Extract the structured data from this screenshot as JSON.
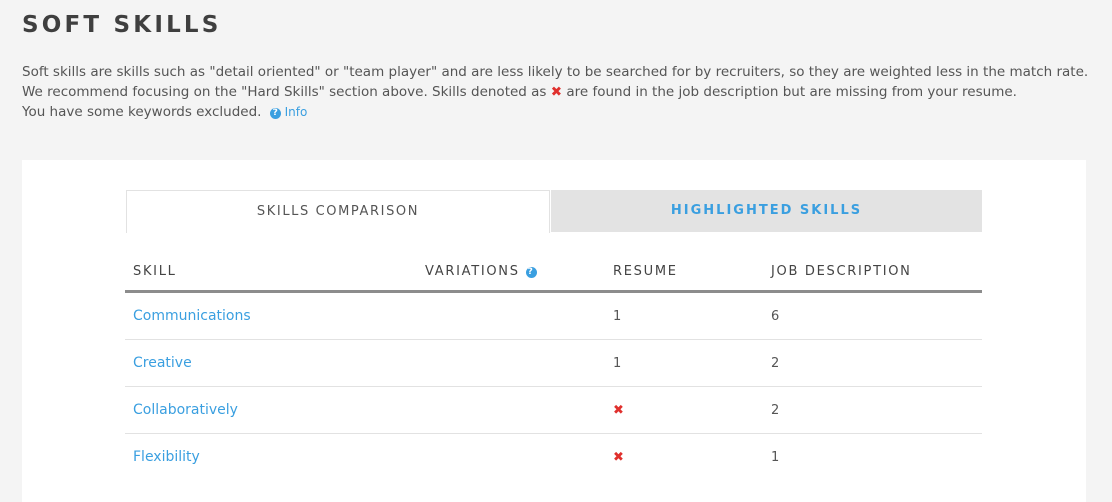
{
  "section": {
    "title": "SOFT SKILLS",
    "description_part1": "Soft skills are skills such as \"detail oriented\" or \"team player\" and are less likely to be searched for by recruiters, so they are weighted less in the match rate. We recommend focusing on the \"Hard Skills\" section above. Skills denoted as ",
    "missing_icon": "✖",
    "description_part2": " are found in the job description but are missing from your resume.",
    "excluded_text": "You have some keywords excluded.",
    "info_icon": "?",
    "info_label": "Info"
  },
  "tabs": [
    {
      "label": "SKILLS COMPARISON",
      "active": true
    },
    {
      "label": "HIGHLIGHTED SKILLS",
      "active": false
    }
  ],
  "table": {
    "headers": {
      "skill": "SKILL",
      "variations": "VARIATIONS",
      "variations_help_icon": "?",
      "resume": "RESUME",
      "job_description": "JOB DESCRIPTION"
    },
    "rows": [
      {
        "skill": "Communications",
        "variations": "",
        "resume": "1",
        "job_description": "6"
      },
      {
        "skill": "Creative",
        "variations": "",
        "resume": "1",
        "job_description": "2"
      },
      {
        "skill": "Collaboratively",
        "variations": "",
        "resume": "✖",
        "job_description": "2"
      },
      {
        "skill": "Flexibility",
        "variations": "",
        "resume": "✖",
        "job_description": "1"
      }
    ]
  },
  "colors": {
    "accent": "#3a9fe0",
    "missing": "#e0302d",
    "background": "#f4f4f4"
  }
}
